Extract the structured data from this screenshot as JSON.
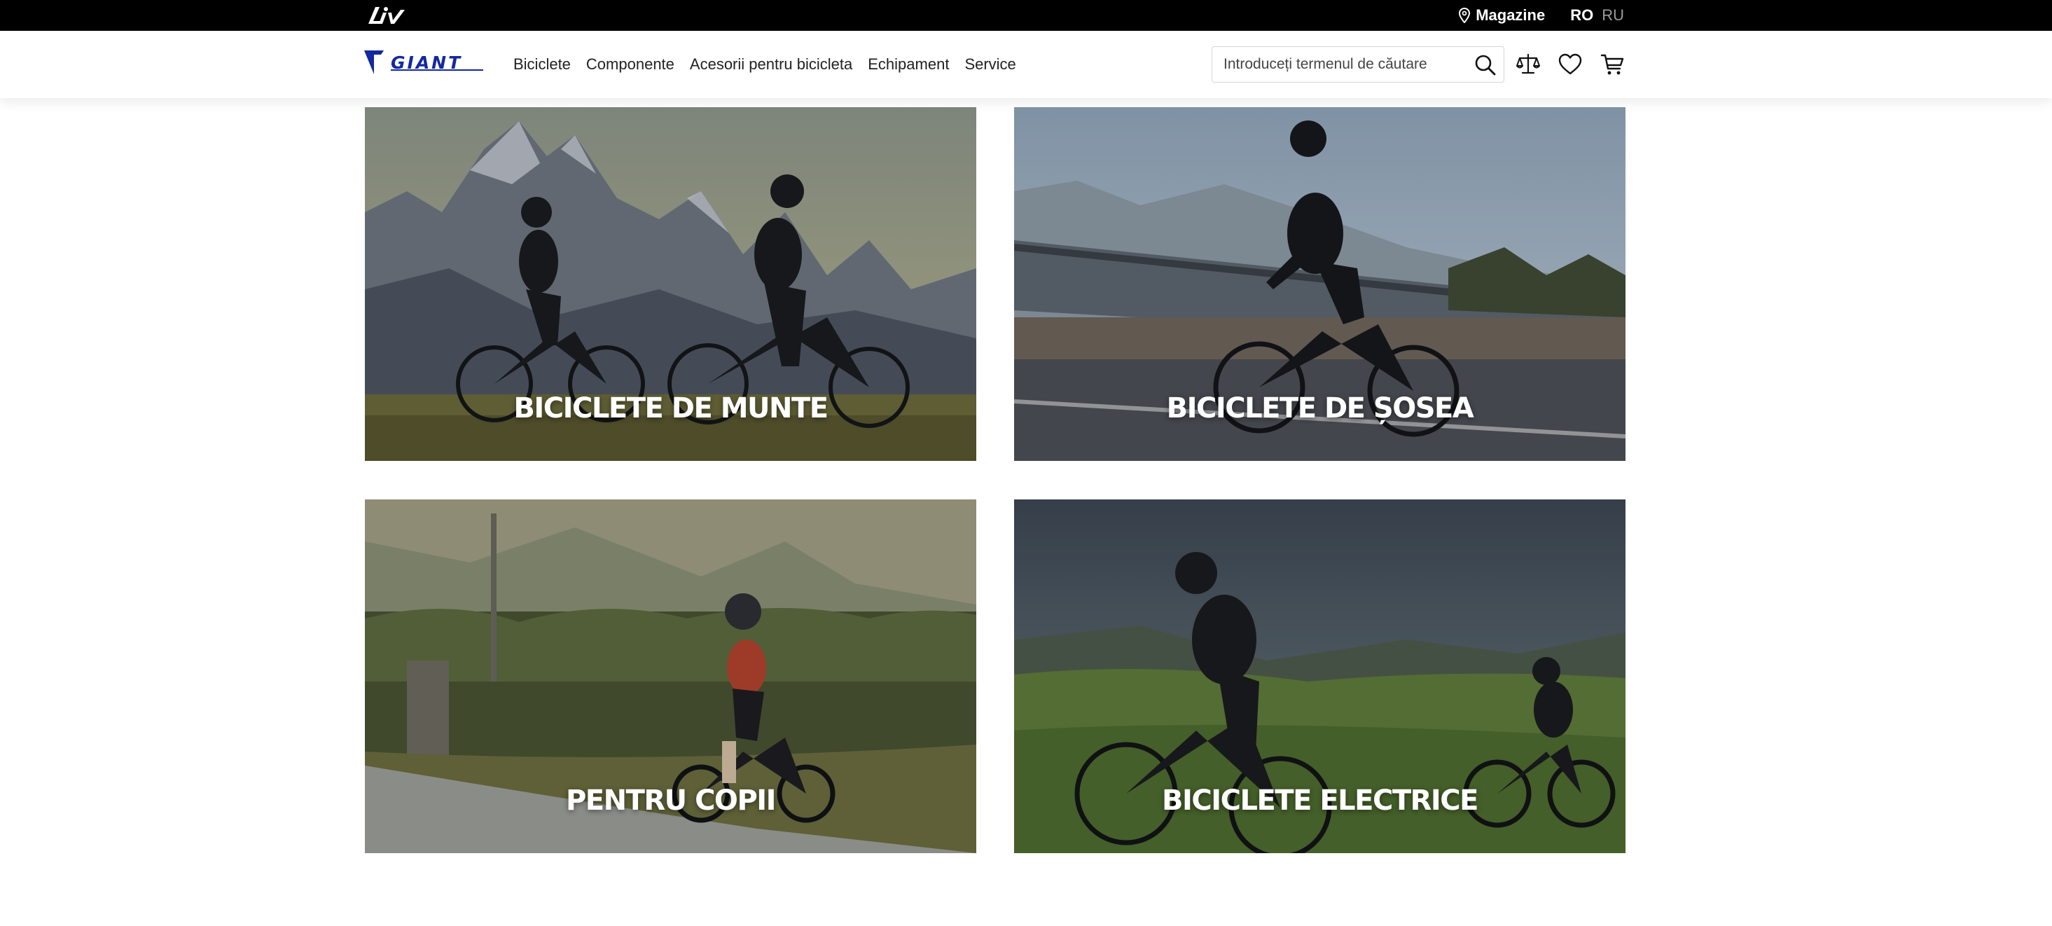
{
  "topbar": {
    "brand_logo": "liv-logo",
    "stores_label": "Magazine",
    "stores_icon": "location-pin-icon",
    "languages": [
      {
        "code": "RO",
        "active": true
      },
      {
        "code": "RU",
        "active": false
      }
    ]
  },
  "header": {
    "logo": "giant-logo",
    "nav": [
      {
        "label": "Biciclete"
      },
      {
        "label": "Componente"
      },
      {
        "label": "Acesorii pentru bicicleta"
      },
      {
        "label": "Echipament"
      },
      {
        "label": "Service"
      }
    ],
    "search": {
      "placeholder": "Introduceți termenul de căutare",
      "value": "",
      "icon": "search-icon"
    },
    "icons": [
      "compare-icon",
      "heart-icon",
      "cart-icon"
    ]
  },
  "categories": [
    {
      "title": "BICICLETE DE MUNTE",
      "image": "mountain-bikers-photo"
    },
    {
      "title": "BICICLETE DE ȘOSEA",
      "image": "road-cyclist-photo"
    },
    {
      "title": "PENTRU COPII",
      "image": "kid-balance-bike-photo"
    },
    {
      "title": "BICICLETE ELECTRICE",
      "image": "ebike-riders-photo"
    }
  ],
  "colors": {
    "topbar_bg": "#000000",
    "brand_blue": "#1428a0",
    "text": "#222222"
  }
}
